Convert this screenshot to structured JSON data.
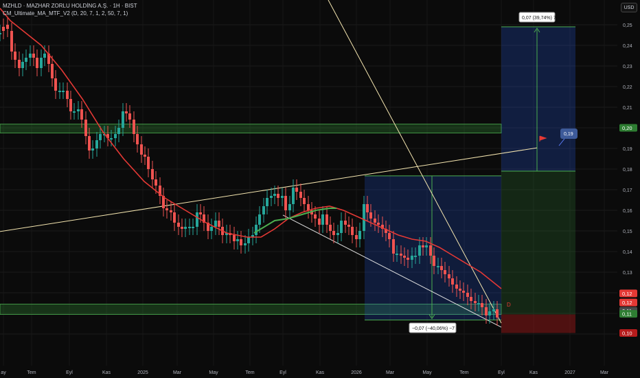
{
  "header": {
    "title": "MZHLD · MAZHAR ZORLU HOLDİNG A.Ş. · 1H · BIST",
    "indicator": "CM_Ultimate_MA_MTF_V2 (D, 20, 7, 1, 2, 50, 7, 1)",
    "currency": "USD"
  },
  "colors": {
    "background": "#0b0b0b",
    "up_candle": "#26a69a",
    "down_candle": "#ef5350",
    "ma_red": "#e53935",
    "ma_green": "#4caf50",
    "zone_green": "#2e7d32",
    "trendline": "#f5e6b0",
    "projection_blue": "#2962ff",
    "projection_red": "#b71c1c"
  },
  "chart_data": {
    "type": "candlestick",
    "y_axis": {
      "ticks": [
        "0,25",
        "0,24",
        "0,23",
        "0,22",
        "0,21",
        "0,20",
        "0,19",
        "0,18",
        "0,17",
        "0,16",
        "0,15",
        "0,14",
        "0,13",
        "0,12",
        "0,11",
        "0,10"
      ],
      "ylim": [
        0.095,
        0.255
      ]
    },
    "x_axis": {
      "ticks": [
        "ay",
        "Tem",
        "Eyl",
        "Kas",
        "2025",
        "Mar",
        "May",
        "Tem",
        "Eyl",
        "Kas",
        "2026",
        "Mar",
        "May",
        "Tem",
        "Eyl",
        "Kas",
        "2027",
        "Mar"
      ]
    },
    "price_labels": [
      {
        "text": "0,20",
        "value": 0.2,
        "color": "#2e7d32"
      },
      {
        "text": "0,12",
        "value": 0.1197,
        "color": "#e53935"
      },
      {
        "text": "0,12",
        "value": 0.1153,
        "color": "#e53935"
      },
      {
        "text": "0,11",
        "value": 0.1113,
        "color": "#4a4a4a"
      },
      {
        "text": "0,11",
        "value": 0.1098,
        "color": "#2e7d32"
      },
      {
        "text": "0,10",
        "value": 0.1005,
        "color": "#b71c1c"
      }
    ],
    "annotations": {
      "target_box": "0,07 (39,74%) 7",
      "stop_box": "−0,07 (−40,06%) −7",
      "flag_value": "0,19",
      "marker": "D"
    },
    "long_position": {
      "entry": 0.179,
      "target": 0.249,
      "stop": 0.109
    },
    "prior_range": {
      "top": 0.1767,
      "bottom": 0.1068
    },
    "support_zones": [
      [
        0.1975,
        0.2018
      ],
      [
        0.1095,
        0.1145
      ]
    ],
    "moving_average_red": [
      [
        0,
        0.258
      ],
      [
        15,
        0.252
      ],
      [
        30,
        0.248
      ],
      [
        60,
        0.24
      ],
      [
        90,
        0.228
      ],
      [
        120,
        0.214
      ],
      [
        150,
        0.198
      ],
      [
        180,
        0.185
      ],
      [
        210,
        0.174
      ],
      [
        240,
        0.166
      ],
      [
        270,
        0.16
      ],
      [
        300,
        0.154
      ],
      [
        330,
        0.149
      ],
      [
        360,
        0.147
      ],
      [
        380,
        0.147
      ],
      [
        400,
        0.151
      ],
      [
        420,
        0.156
      ],
      [
        440,
        0.159
      ],
      [
        460,
        0.161
      ],
      [
        480,
        0.162
      ],
      [
        500,
        0.16
      ],
      [
        520,
        0.157
      ],
      [
        540,
        0.154
      ],
      [
        560,
        0.151
      ],
      [
        580,
        0.148
      ],
      [
        600,
        0.146
      ],
      [
        620,
        0.145
      ],
      [
        640,
        0.142
      ],
      [
        660,
        0.138
      ],
      [
        680,
        0.134
      ],
      [
        700,
        0.13
      ],
      [
        715,
        0.126
      ],
      [
        730,
        0.122
      ]
    ],
    "moving_average_green": [
      [
        370,
        0.149
      ],
      [
        380,
        0.151
      ],
      [
        390,
        0.153
      ],
      [
        400,
        0.155
      ],
      [
        420,
        0.156
      ],
      [
        440,
        0.158
      ],
      [
        460,
        0.16
      ],
      [
        480,
        0.161
      ],
      [
        490,
        0.161
      ]
    ],
    "candles": [
      [
        0,
        0.246,
        0.246
      ],
      [
        5,
        0.249,
        0.247
      ],
      [
        11,
        0.25,
        0.248
      ],
      [
        17,
        0.247,
        0.237
      ],
      [
        22,
        0.237,
        0.233
      ],
      [
        28,
        0.233,
        0.229
      ],
      [
        33,
        0.229,
        0.232
      ],
      [
        38,
        0.232,
        0.234
      ],
      [
        44,
        0.234,
        0.236
      ],
      [
        49,
        0.236,
        0.234
      ],
      [
        54,
        0.234,
        0.229
      ],
      [
        60,
        0.229,
        0.234
      ],
      [
        65,
        0.234,
        0.236
      ],
      [
        71,
        0.236,
        0.231
      ],
      [
        76,
        0.231,
        0.224
      ],
      [
        81,
        0.224,
        0.218
      ],
      [
        87,
        0.218,
        0.218
      ],
      [
        92,
        0.218,
        0.218
      ],
      [
        98,
        0.218,
        0.214
      ],
      [
        103,
        0.214,
        0.208
      ],
      [
        108,
        0.208,
        0.208
      ],
      [
        114,
        0.208,
        0.209
      ],
      [
        119,
        0.209,
        0.204
      ],
      [
        125,
        0.204,
        0.196
      ],
      [
        130,
        0.196,
        0.189
      ],
      [
        135,
        0.189,
        0.19
      ],
      [
        141,
        0.19,
        0.194
      ],
      [
        146,
        0.194,
        0.197
      ],
      [
        152,
        0.197,
        0.197
      ],
      [
        157,
        0.197,
        0.195
      ],
      [
        162,
        0.195,
        0.195
      ],
      [
        168,
        0.195,
        0.197
      ],
      [
        173,
        0.197,
        0.2
      ],
      [
        179,
        0.2,
        0.208
      ],
      [
        184,
        0.208,
        0.207
      ],
      [
        189,
        0.207,
        0.204
      ],
      [
        195,
        0.204,
        0.197
      ],
      [
        200,
        0.197,
        0.192
      ],
      [
        206,
        0.192,
        0.187
      ],
      [
        211,
        0.187,
        0.186
      ],
      [
        216,
        0.186,
        0.18
      ],
      [
        222,
        0.18,
        0.175
      ],
      [
        227,
        0.175,
        0.172
      ],
      [
        233,
        0.172,
        0.167
      ],
      [
        238,
        0.167,
        0.161
      ],
      [
        243,
        0.161,
        0.16
      ],
      [
        249,
        0.16,
        0.159
      ],
      [
        254,
        0.159,
        0.154
      ],
      [
        260,
        0.154,
        0.152
      ],
      [
        265,
        0.152,
        0.151
      ],
      [
        270,
        0.151,
        0.152
      ],
      [
        276,
        0.152,
        0.152
      ],
      [
        281,
        0.152,
        0.152
      ],
      [
        287,
        0.152,
        0.159
      ],
      [
        292,
        0.159,
        0.158
      ],
      [
        297,
        0.158,
        0.154
      ],
      [
        303,
        0.154,
        0.15
      ],
      [
        308,
        0.15,
        0.152
      ],
      [
        314,
        0.152,
        0.155
      ],
      [
        319,
        0.155,
        0.152
      ],
      [
        324,
        0.152,
        0.148
      ],
      [
        330,
        0.148,
        0.149
      ],
      [
        335,
        0.149,
        0.148
      ],
      [
        341,
        0.148,
        0.145
      ],
      [
        346,
        0.145,
        0.146
      ],
      [
        351,
        0.146,
        0.143
      ],
      [
        357,
        0.143,
        0.144
      ],
      [
        362,
        0.144,
        0.147
      ],
      [
        368,
        0.147,
        0.148
      ],
      [
        373,
        0.148,
        0.153
      ],
      [
        378,
        0.153,
        0.158
      ],
      [
        384,
        0.158,
        0.162
      ],
      [
        389,
        0.162,
        0.166
      ],
      [
        395,
        0.166,
        0.167
      ],
      [
        400,
        0.167,
        0.168
      ],
      [
        405,
        0.168,
        0.166
      ],
      [
        411,
        0.166,
        0.167
      ],
      [
        416,
        0.167,
        0.16
      ],
      [
        422,
        0.16,
        0.163
      ],
      [
        427,
        0.163,
        0.171
      ],
      [
        432,
        0.171,
        0.169
      ],
      [
        438,
        0.169,
        0.166
      ],
      [
        443,
        0.166,
        0.163
      ],
      [
        449,
        0.163,
        0.16
      ],
      [
        454,
        0.16,
        0.158
      ],
      [
        459,
        0.158,
        0.156
      ],
      [
        465,
        0.156,
        0.153
      ],
      [
        470,
        0.153,
        0.158
      ],
      [
        476,
        0.158,
        0.153
      ],
      [
        481,
        0.153,
        0.15
      ],
      [
        486,
        0.15,
        0.148
      ],
      [
        492,
        0.148,
        0.149
      ],
      [
        497,
        0.149,
        0.155
      ],
      [
        503,
        0.155,
        0.153
      ],
      [
        508,
        0.153,
        0.152
      ],
      [
        513,
        0.152,
        0.148
      ],
      [
        519,
        0.148,
        0.146
      ],
      [
        524,
        0.146,
        0.15
      ],
      [
        530,
        0.15,
        0.163
      ],
      [
        535,
        0.163,
        0.159
      ],
      [
        540,
        0.159,
        0.156
      ],
      [
        546,
        0.156,
        0.154
      ],
      [
        551,
        0.154,
        0.153
      ],
      [
        557,
        0.153,
        0.151
      ],
      [
        562,
        0.151,
        0.149
      ],
      [
        567,
        0.149,
        0.146
      ],
      [
        573,
        0.146,
        0.139
      ],
      [
        578,
        0.139,
        0.139
      ],
      [
        584,
        0.139,
        0.138
      ],
      [
        589,
        0.138,
        0.137
      ],
      [
        594,
        0.137,
        0.136
      ],
      [
        600,
        0.136,
        0.138
      ],
      [
        605,
        0.138,
        0.138
      ],
      [
        611,
        0.138,
        0.143
      ],
      [
        616,
        0.143,
        0.142
      ],
      [
        621,
        0.142,
        0.143
      ],
      [
        627,
        0.143,
        0.138
      ],
      [
        632,
        0.138,
        0.133
      ],
      [
        638,
        0.133,
        0.133
      ],
      [
        643,
        0.133,
        0.131
      ],
      [
        648,
        0.131,
        0.129
      ],
      [
        654,
        0.129,
        0.127
      ],
      [
        659,
        0.127,
        0.124
      ],
      [
        665,
        0.124,
        0.122
      ],
      [
        670,
        0.122,
        0.121
      ],
      [
        675,
        0.121,
        0.12
      ],
      [
        681,
        0.12,
        0.118
      ],
      [
        686,
        0.118,
        0.116
      ],
      [
        692,
        0.116,
        0.115
      ],
      [
        697,
        0.115,
        0.115
      ],
      [
        702,
        0.115,
        0.113
      ],
      [
        708,
        0.113,
        0.109
      ],
      [
        713,
        0.109,
        0.111
      ],
      [
        719,
        0.111,
        0.112
      ],
      [
        724,
        0.112,
        0.108
      ]
    ]
  }
}
